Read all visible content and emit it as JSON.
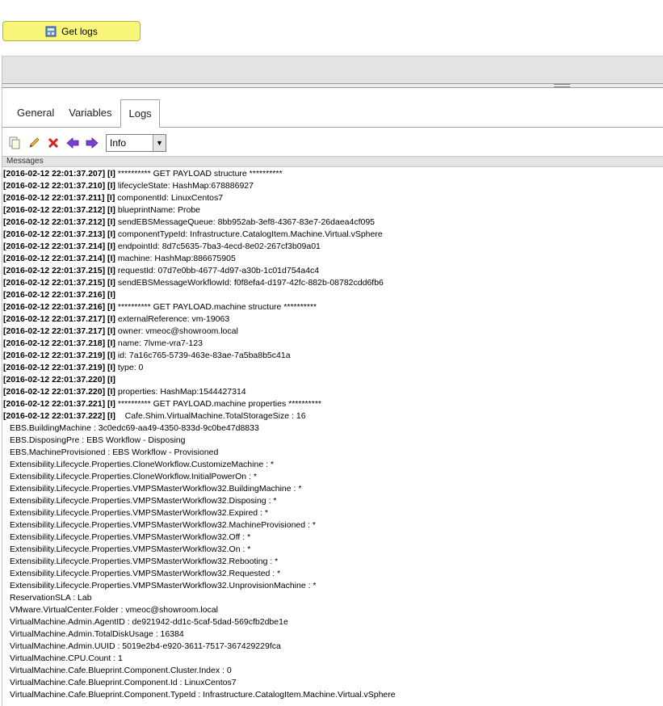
{
  "get_logs_button": {
    "label": "Get logs"
  },
  "tabs": [
    {
      "label": "General",
      "active": false
    },
    {
      "label": "Variables",
      "active": false
    },
    {
      "label": "Logs",
      "active": true
    }
  ],
  "toolbar": {
    "icons": [
      "copy-icon",
      "edit-icon",
      "delete-icon",
      "arrow-left-icon",
      "arrow-right-icon"
    ],
    "level_select": {
      "value": "Info"
    }
  },
  "messages_header": "Messages",
  "log_lines": [
    {
      "ts": "[2016-02-12 22:01:37.207]",
      "level": "[I]",
      "msg": "********** GET PAYLOAD structure **********"
    },
    {
      "ts": "[2016-02-12 22:01:37.210]",
      "level": "[I]",
      "msg": "lifecycleState: HashMap:678886927"
    },
    {
      "ts": "[2016-02-12 22:01:37.211]",
      "level": "[I]",
      "msg": "componentId: LinuxCentos7"
    },
    {
      "ts": "[2016-02-12 22:01:37.212]",
      "level": "[I]",
      "msg": "blueprintName: Probe"
    },
    {
      "ts": "[2016-02-12 22:01:37.212]",
      "level": "[I]",
      "msg": "sendEBSMessageQueue: 8bb952ab-3ef8-4367-83e7-26daea4cf095"
    },
    {
      "ts": "[2016-02-12 22:01:37.213]",
      "level": "[I]",
      "msg": "componentTypeId: Infrastructure.CatalogItem.Machine.Virtual.vSphere"
    },
    {
      "ts": "[2016-02-12 22:01:37.214]",
      "level": "[I]",
      "msg": "endpointId: 8d7c5635-7ba3-4ecd-8e02-267cf3b09a01"
    },
    {
      "ts": "[2016-02-12 22:01:37.214]",
      "level": "[I]",
      "msg": "machine: HashMap:886675905"
    },
    {
      "ts": "[2016-02-12 22:01:37.215]",
      "level": "[I]",
      "msg": "requestId: 07d7e0bb-4677-4d97-a30b-1c01d754a4c4"
    },
    {
      "ts": "[2016-02-12 22:01:37.215]",
      "level": "[I]",
      "msg": "sendEBSMessageWorkflowId: f0f8efa4-d197-42fc-882b-08782cdd6fb6"
    },
    {
      "ts": "[2016-02-12 22:01:37.216]",
      "level": "[I]",
      "msg": ""
    },
    {
      "ts": "[2016-02-12 22:01:37.216]",
      "level": "[I]",
      "msg": "********** GET PAYLOAD.machine structure **********"
    },
    {
      "ts": "[2016-02-12 22:01:37.217]",
      "level": "[I]",
      "msg": "externalReference: vm-19063"
    },
    {
      "ts": "[2016-02-12 22:01:37.217]",
      "level": "[I]",
      "msg": "owner: vmeoc@showroom.local"
    },
    {
      "ts": "[2016-02-12 22:01:37.218]",
      "level": "[I]",
      "msg": "name: 7lvme-vra7-123"
    },
    {
      "ts": "[2016-02-12 22:01:37.219]",
      "level": "[I]",
      "msg": "id: 7a16c765-5739-463e-83ae-7a5ba8b5c41a"
    },
    {
      "ts": "[2016-02-12 22:01:37.219]",
      "level": "[I]",
      "msg": "type: 0"
    },
    {
      "ts": "[2016-02-12 22:01:37.220]",
      "level": "[I]",
      "msg": ""
    },
    {
      "ts": "[2016-02-12 22:01:37.220]",
      "level": "[I]",
      "msg": "properties: HashMap:1544427314"
    },
    {
      "ts": "[2016-02-12 22:01:37.221]",
      "level": "[I]",
      "msg": "********** GET PAYLOAD.machine properties **********"
    },
    {
      "ts": "[2016-02-12 22:01:37.222]",
      "level": "[I]",
      "msg": "   Cafe.Shim.VirtualMachine.TotalStorageSize : 16"
    }
  ],
  "continuation_lines": [
    "EBS.BuildingMachine : 3c0edc69-aa49-4350-833d-9c0be47d8833",
    "EBS.DisposingPre : EBS Workflow - Disposing",
    "EBS.MachineProvisioned : EBS Workflow - Provisioned",
    "Extensibility.Lifecycle.Properties.CloneWorkflow.CustomizeMachine : *",
    "Extensibility.Lifecycle.Properties.CloneWorkflow.InitialPowerOn : *",
    "Extensibility.Lifecycle.Properties.VMPSMasterWorkflow32.BuildingMachine : *",
    "Extensibility.Lifecycle.Properties.VMPSMasterWorkflow32.Disposing : *",
    "Extensibility.Lifecycle.Properties.VMPSMasterWorkflow32.Expired : *",
    "Extensibility.Lifecycle.Properties.VMPSMasterWorkflow32.MachineProvisioned : *",
    "Extensibility.Lifecycle.Properties.VMPSMasterWorkflow32.Off : *",
    "Extensibility.Lifecycle.Properties.VMPSMasterWorkflow32.On : *",
    "Extensibility.Lifecycle.Properties.VMPSMasterWorkflow32.Rebooting : *",
    "Extensibility.Lifecycle.Properties.VMPSMasterWorkflow32.Requested : *",
    "Extensibility.Lifecycle.Properties.VMPSMasterWorkflow32.UnprovisionMachine : *",
    "ReservationSLA : Lab",
    "VMware.VirtualCenter.Folder : vmeoc@showroom.local",
    "VirtualMachine.Admin.AgentID : de921942-dd1c-5caf-5dad-569cfb2dbe1e",
    "VirtualMachine.Admin.TotalDiskUsage : 16384",
    "VirtualMachine.Admin.UUID : 5019e2b4-e920-3611-7517-367429229fca",
    "VirtualMachine.CPU.Count : 1",
    "VirtualMachine.Cafe.Blueprint.Component.Cluster.Index : 0",
    "VirtualMachine.Cafe.Blueprint.Component.Id : LinuxCentos7",
    "VirtualMachine.Cafe.Blueprint.Component.TypeId : Infrastructure.CatalogItem.Machine.Virtual.vSphere"
  ]
}
